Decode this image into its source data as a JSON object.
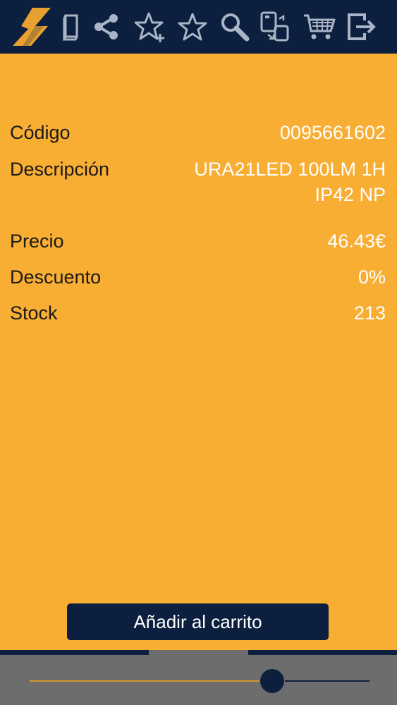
{
  "toolbar": {
    "icons": [
      "logo-icon",
      "catalog-icon",
      "share-icon",
      "add-favorite-icon",
      "favorite-icon",
      "search-icon",
      "device-sync-icon",
      "cart-icon",
      "logout-icon"
    ]
  },
  "product": {
    "code": {
      "label": "Código",
      "value": "0095661602"
    },
    "description": {
      "label": "Descripción",
      "value": "URA21LED 100LM 1H IP42 NP"
    },
    "price": {
      "label": "Precio",
      "value": "46.43€"
    },
    "discount": {
      "label": "Descuento",
      "value": "0%"
    },
    "stock": {
      "label": "Stock",
      "value": "213"
    }
  },
  "actions": {
    "add_to_cart_label": "Añadir al carrito"
  },
  "slider": {
    "value_fraction": 0.7
  },
  "colors": {
    "toolbar_bg": "#0c1f3f",
    "content_bg": "#f8ad33",
    "icon_color": "#aab4c4",
    "logo_accent": "#e8a030",
    "value_text": "#ffffff",
    "bottom_bar": "#6d6d6d"
  }
}
